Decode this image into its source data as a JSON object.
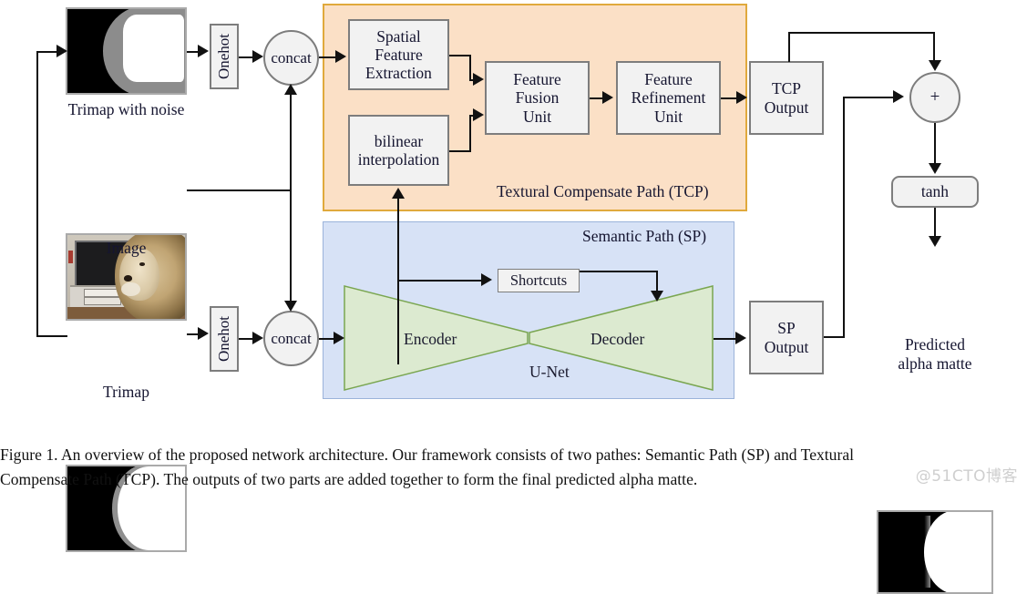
{
  "figure": {
    "caption_line1": "Figure 1. An overview of the proposed network architecture.  Our framework consists of two pathes:  Semantic Path (SP) and Textural",
    "caption_line2": "Compensate Path (TCP). The outputs of two parts are added together to form the final predicted alpha matte.",
    "watermark": "@51CTO博客"
  },
  "inputs": {
    "trimap_noise_label": "Trimap with noise",
    "image_label": "Image",
    "trimap_label": "Trimap"
  },
  "ops": {
    "onehot_top": "Onehot",
    "onehot_bottom": "Onehot",
    "concat_top": "concat",
    "concat_bottom": "concat",
    "add": "+",
    "tanh": "tanh"
  },
  "tcp": {
    "title": "Textural Compensate Path (TCP)",
    "spatial_feature_extraction": "Spatial\nFeature\nExtraction",
    "sfe_l1": "Spatial",
    "sfe_l2": "Feature",
    "sfe_l3": "Extraction",
    "bilinear_l1": "bilinear",
    "bilinear_l2": "interpolation",
    "ffu_l1": "Feature",
    "ffu_l2": "Fusion",
    "ffu_l3": "Unit",
    "fru_l1": "Feature",
    "fru_l2": "Refinement",
    "fru_l3": "Unit",
    "output_l1": "TCP",
    "output_l2": "Output"
  },
  "sp": {
    "title": "Semantic Path (SP)",
    "shortcuts": "Shortcuts",
    "encoder": "Encoder",
    "decoder": "Decoder",
    "unet": "U-Net",
    "output_l1": "SP",
    "output_l2": "Output"
  },
  "output": {
    "predicted_l1": "Predicted",
    "predicted_l2": "alpha matte"
  },
  "colors": {
    "tcp_panel_bg": "#fbe0c6",
    "tcp_panel_border": "#e0a93c",
    "sp_panel_bg": "#d7e2f6",
    "sp_panel_border": "#9bb3da",
    "unet_fill": "#dcead0",
    "unet_border": "#7aa651",
    "node_fill": "#f2f2f2",
    "node_border": "#7d7d7d",
    "line": "#111111"
  }
}
